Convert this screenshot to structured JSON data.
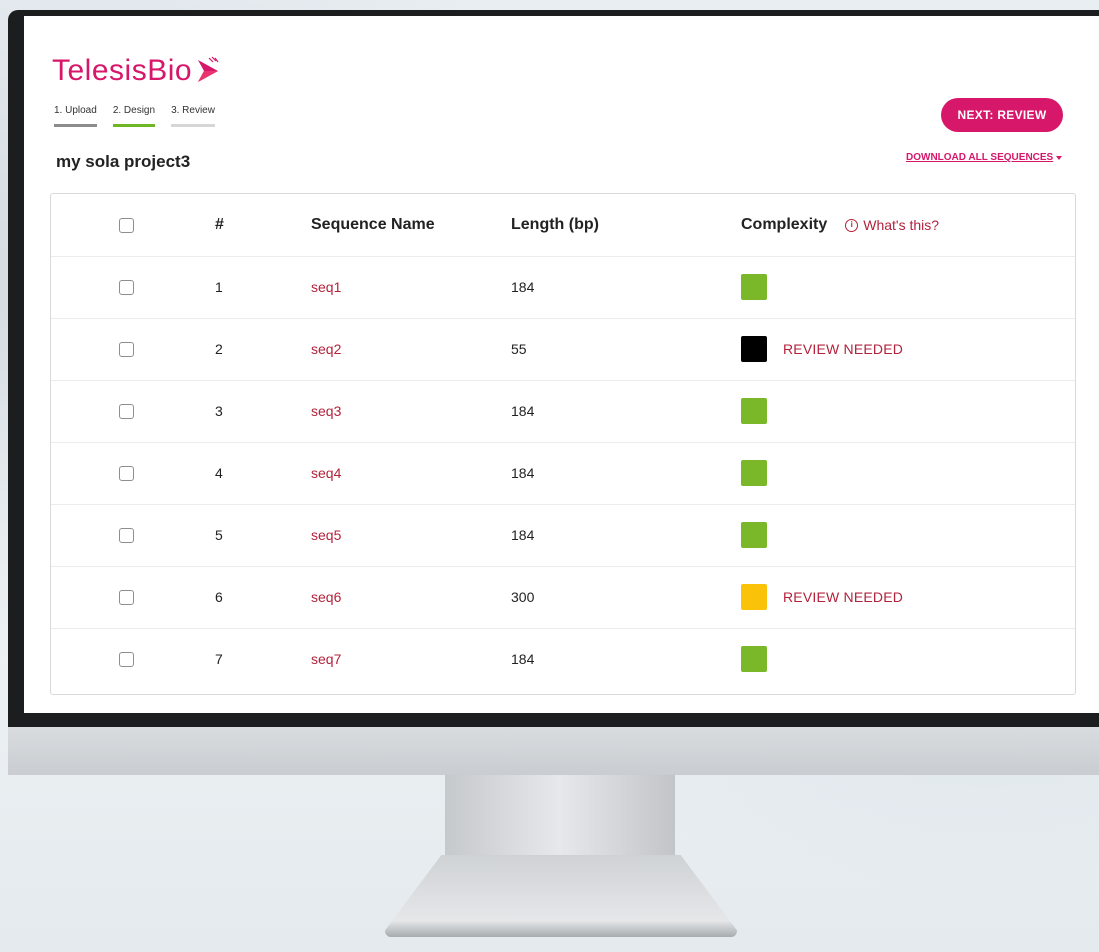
{
  "brand": {
    "name": "TelesisBio",
    "accent": "#d6176a"
  },
  "steps": [
    {
      "label": "1. Upload",
      "state": "done"
    },
    {
      "label": "2. Design",
      "state": "active"
    },
    {
      "label": "3. Review",
      "state": "future"
    }
  ],
  "next_button": "NEXT: REVIEW",
  "project_title": "my sola project3",
  "download_all": "DOWNLOAD ALL SEQUENCES",
  "table": {
    "headers": {
      "num": "#",
      "name": "Sequence Name",
      "length": "Length (bp)",
      "complexity": "Complexity",
      "whats_this": "What's this?"
    },
    "rows": [
      {
        "num": "1",
        "name": "seq1",
        "length": "184",
        "complexity_color": "#7ab829",
        "status": ""
      },
      {
        "num": "2",
        "name": "seq2",
        "length": "55",
        "complexity_color": "#000000",
        "status": "REVIEW NEEDED"
      },
      {
        "num": "3",
        "name": "seq3",
        "length": "184",
        "complexity_color": "#7ab829",
        "status": ""
      },
      {
        "num": "4",
        "name": "seq4",
        "length": "184",
        "complexity_color": "#7ab829",
        "status": ""
      },
      {
        "num": "5",
        "name": "seq5",
        "length": "184",
        "complexity_color": "#7ab829",
        "status": ""
      },
      {
        "num": "6",
        "name": "seq6",
        "length": "300",
        "complexity_color": "#fbc20a",
        "status": "REVIEW NEEDED"
      },
      {
        "num": "7",
        "name": "seq7",
        "length": "184",
        "complexity_color": "#7ab829",
        "status": ""
      }
    ]
  }
}
